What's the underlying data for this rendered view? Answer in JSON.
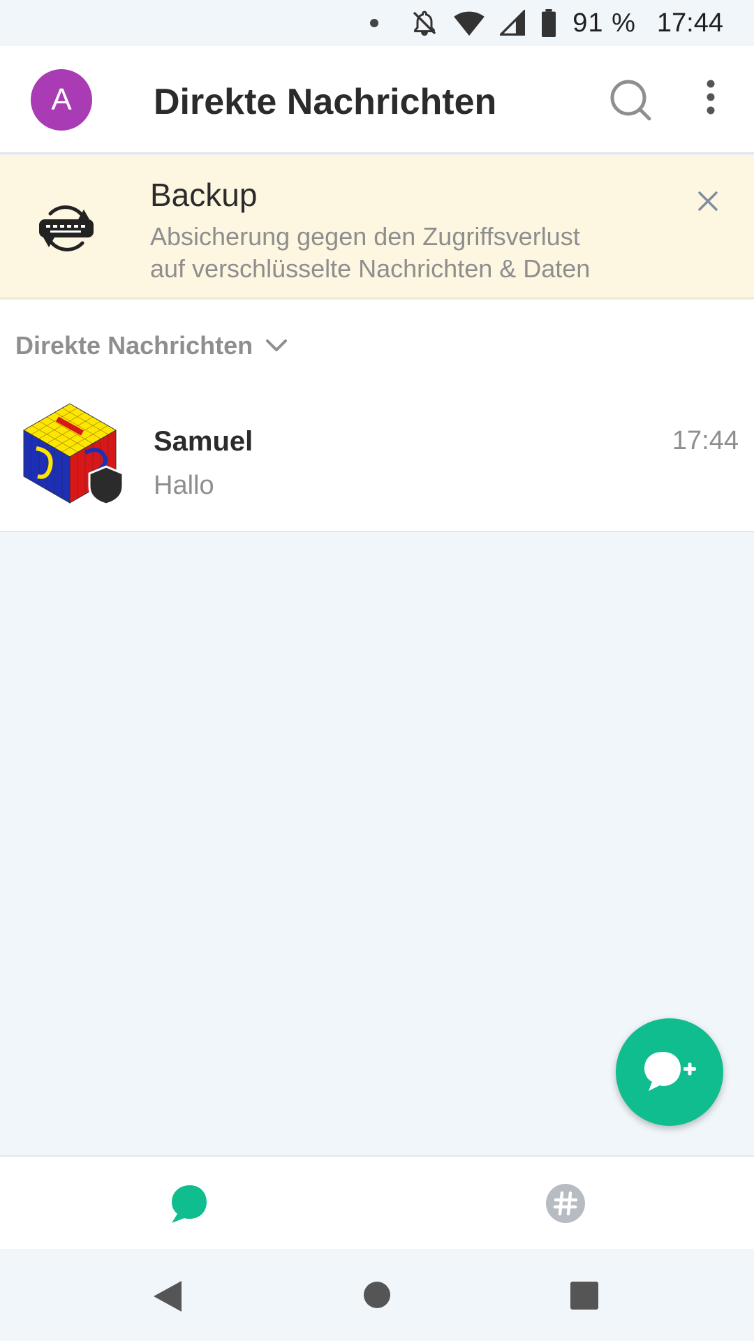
{
  "status_bar": {
    "battery": "91 %",
    "time": "17:44"
  },
  "header": {
    "avatar_letter": "A",
    "title": "Direkte Nachrichten"
  },
  "banner": {
    "title": "Backup",
    "description_line1": "Absicherung gegen den Zugriffsverlust",
    "description_line2": "auf verschlüsselte Nachrichten & Daten"
  },
  "section": {
    "title": "Direkte Nachrichten",
    "conversations": [
      {
        "name": "Samuel",
        "last_message": "Hallo",
        "time": "17:44"
      }
    ]
  },
  "colors": {
    "accent": "#10bd8e",
    "avatar": "#a93bb5",
    "banner_bg": "#fdf6e0",
    "background": "#f1f6fa"
  },
  "icons": {
    "search": "search-icon",
    "more": "more-vertical-icon",
    "backup": "backup-sync-icon",
    "close": "close-icon",
    "fab": "new-chat-icon",
    "tab_dm": "chat-bubble-icon",
    "tab_rooms": "hash-icon"
  }
}
